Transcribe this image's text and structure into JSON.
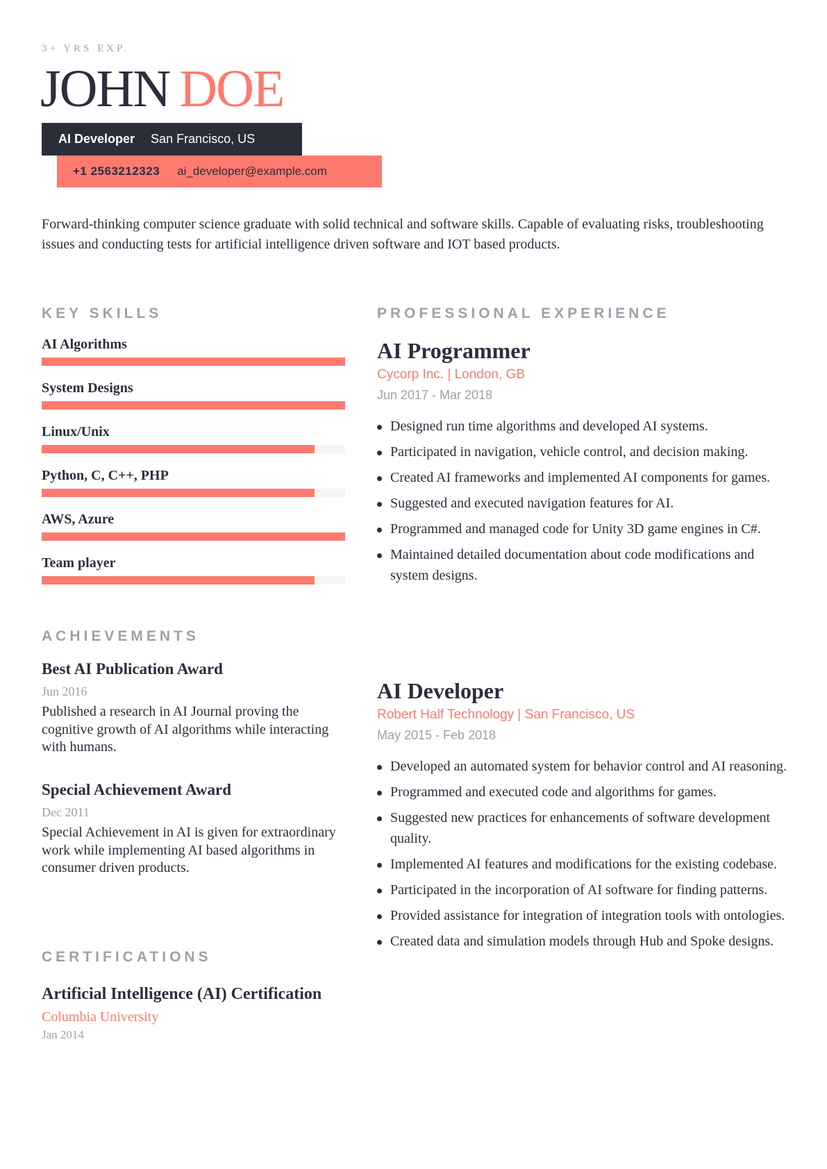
{
  "header": {
    "experience_tag": "3+ YRS EXP.",
    "first_name": "JOHN",
    "last_name": "DOE",
    "role": "AI Developer",
    "location": "San Francisco, US",
    "phone": "+1 2563212323",
    "email": "ai_developer@example.com"
  },
  "summary": "Forward-thinking computer science graduate with solid technical and software skills. Capable of evaluating risks, troubleshooting issues and conducting tests for artificial intelligence driven software and IOT based products.",
  "colors": {
    "accent": "#fe7a6e",
    "dark": "#2a2e38",
    "muted": "#9ea1aa"
  },
  "skills": {
    "heading": "KEY SKILLS",
    "items": [
      {
        "name": "AI Algorithms",
        "level": 1.0
      },
      {
        "name": "System Designs",
        "level": 1.0
      },
      {
        "name": "Linux/Unix",
        "level": 0.9
      },
      {
        "name": "Python, C, C++, PHP",
        "level": 0.9
      },
      {
        "name": "AWS, Azure",
        "level": 1.0
      },
      {
        "name": "Team player",
        "level": 0.9
      }
    ]
  },
  "achievements": {
    "heading": "ACHIEVEMENTS",
    "items": [
      {
        "title": "Best AI Publication Award",
        "date": "Jun 2016",
        "description": "Published a research in AI Journal proving the cognitive growth of AI algorithms while interacting with humans."
      },
      {
        "title": "Special Achievement Award",
        "date": "Dec 2011",
        "description": "Special Achievement in AI is given for extraordinary work while implementing AI based algorithms in consumer driven products."
      }
    ]
  },
  "certifications": {
    "heading": "CERTIFICATIONS",
    "items": [
      {
        "title": "Artificial Intelligence (AI) Certification",
        "organization": "Columbia University",
        "date": "Jan 2014"
      }
    ]
  },
  "experience": {
    "heading": "PROFESSIONAL EXPERIENCE",
    "jobs": [
      {
        "title": "AI Programmer",
        "company": "Cycorp Inc. | London, GB",
        "dates": "Jun 2017 - Mar 2018",
        "bullets": [
          "Designed run time algorithms and developed AI systems.",
          "Participated in navigation, vehicle control, and decision making.",
          "Created AI frameworks and implemented AI components for games.",
          "Suggested and executed navigation features for AI.",
          "Programmed and managed code for Unity 3D game engines in C#.",
          "Maintained detailed documentation about code modifications and system designs."
        ]
      },
      {
        "title": "AI Developer",
        "company": "Robert Half Technology | San Francisco, US",
        "dates": "May 2015 - Feb 2018",
        "bullets": [
          "Developed an automated system for behavior control and AI reasoning.",
          "Programmed and executed code and algorithms for games.",
          "Suggested new practices for enhancements of software development quality.",
          "Implemented AI features and modifications for the existing codebase.",
          "Participated in the incorporation of AI software for finding patterns.",
          "Provided assistance for integration of integration tools with ontologies.",
          "Created data and simulation models through Hub and Spoke designs."
        ]
      }
    ]
  }
}
